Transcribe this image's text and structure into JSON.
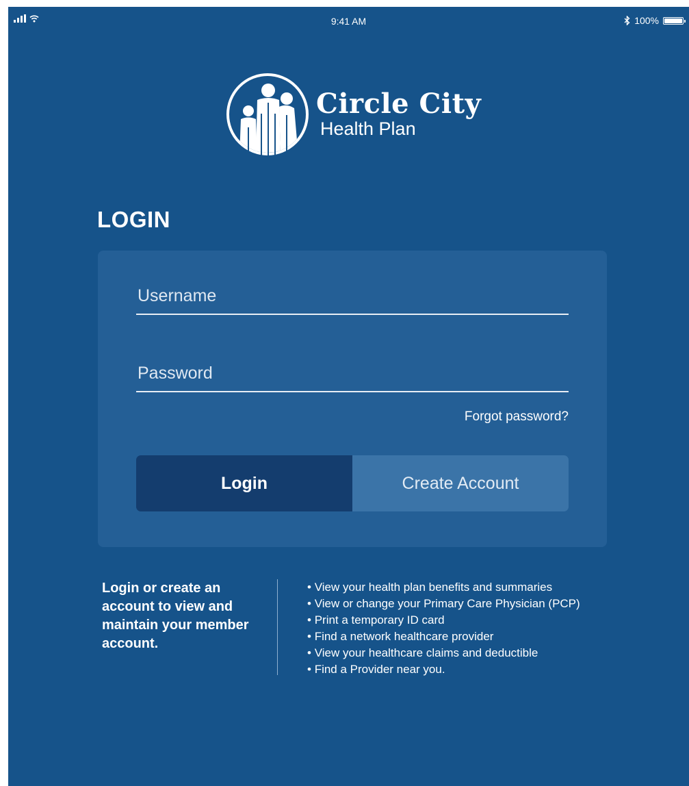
{
  "status_bar": {
    "time": "9:41 AM",
    "battery": "100%",
    "battery_level": 1.0
  },
  "logo": {
    "title": "Circle City",
    "subtitle": "Health Plan"
  },
  "login": {
    "heading": "LOGIN",
    "username_placeholder": "Username",
    "password_placeholder": "Password",
    "forgot_label": "Forgot password?",
    "login_label": "Login",
    "create_label": "Create Account"
  },
  "info": {
    "text": "Login or create an account to view and maintain your member account.",
    "features": [
      "View your health plan benefits and summaries",
      "View or change your Primary Care Physician (PCP)",
      "Print a temporary ID card",
      "Find a network healthcare provider",
      "View your healthcare claims and deductible",
      "Find a Provider near you."
    ]
  },
  "colors": {
    "background": "#16538a",
    "card": "#245f96",
    "login_button": "#143d6e",
    "create_button": "#3b74a8"
  },
  "icons": {
    "signal": "signal-icon",
    "wifi": "wifi-icon",
    "bluetooth": "bluetooth-icon",
    "battery": "battery-icon"
  }
}
